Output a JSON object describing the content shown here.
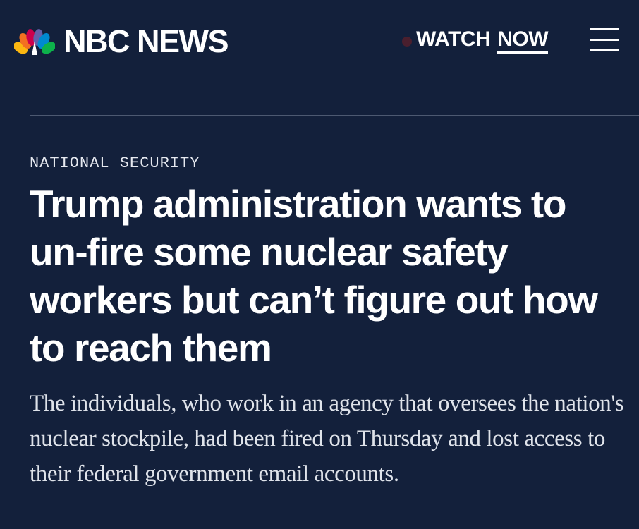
{
  "header": {
    "brand": "NBC NEWS",
    "watch_prefix": "WATCH",
    "watch_now": "NOW",
    "menu_icon": "hamburger-menu-icon",
    "logo_icon": "nbc-peacock-icon",
    "live_dot_color": "#4a1f2e"
  },
  "article": {
    "section": "NATIONAL SECURITY",
    "headline": "Trump administration wants to un-fire some nuclear safety workers but can’t figure out how to reach them",
    "dek": "The individuals, who work in an agency that oversees the nation's nuclear stockpile, had been fired on Thursday and lost access to their federal government email accounts."
  },
  "colors": {
    "background": "#13203b",
    "text": "#ffffff",
    "divider": "#4d5971"
  }
}
